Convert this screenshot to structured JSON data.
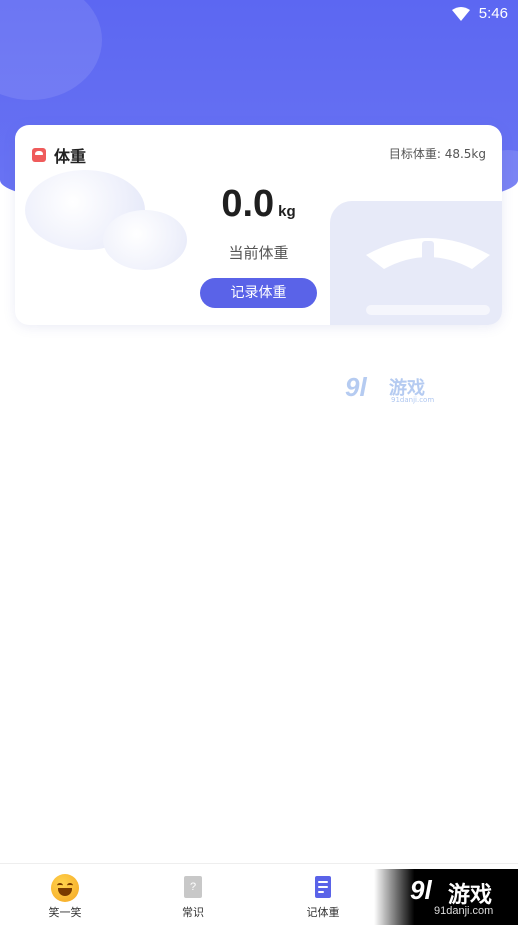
{
  "status_bar": {
    "time": "5:46"
  },
  "card": {
    "title": "体重",
    "target": "目标体重: 48.5kg",
    "weight_value": "0.0",
    "weight_unit": "kg",
    "current_label": "当前体重",
    "record_button": "记录体重"
  },
  "watermark_mid": {
    "num": "9l",
    "text": "游戏",
    "url": "91danji.com"
  },
  "tabs": [
    {
      "label": "笑一笑",
      "icon": "smile-icon"
    },
    {
      "label": "常识",
      "icon": "question-doc-icon",
      "glyph": "?"
    },
    {
      "label": "记体重",
      "icon": "note-icon"
    }
  ],
  "watermark_br": {
    "num": "9l",
    "text": "游戏",
    "url": "91danji.com"
  },
  "colors": {
    "accent": "#5a63e8",
    "header": "#5c67f2",
    "scale_icon": "#ef5b5b"
  }
}
